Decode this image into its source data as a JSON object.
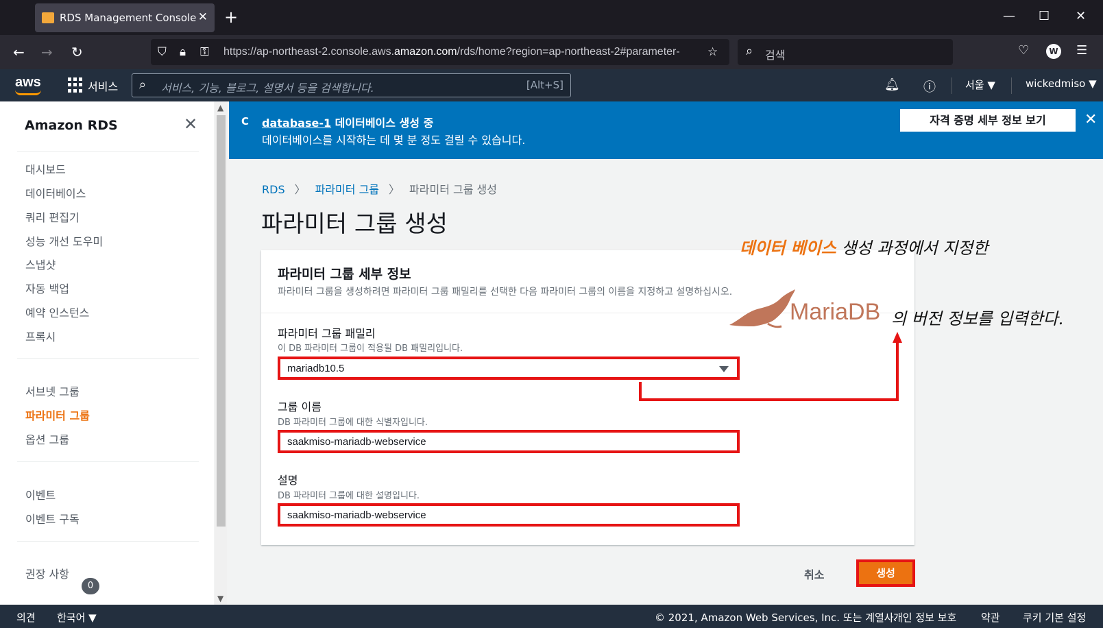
{
  "browser": {
    "tab_title": "RDS Management Console",
    "url_prefix": "https://ap-northeast-2.console.aws.",
    "url_domain": "amazon.com",
    "url_suffix": "/rds/home?region=ap-northeast-2#parameter-",
    "search_placeholder": "검색"
  },
  "aws_header": {
    "logo": "aws",
    "services_label": "서비스",
    "search_placeholder": "서비스, 기능, 블로그, 설명서 등을 검색합니다.",
    "search_shortcut": "[Alt+S]",
    "region": "서울 ▼",
    "account": "wickedmiso ▼"
  },
  "sidebar": {
    "title": "Amazon RDS",
    "items": [
      "대시보드",
      "데이터베이스",
      "쿼리 편집기",
      "성능 개선 도우미",
      "스냅샷",
      "자동 백업",
      "예약 인스턴스",
      "프록시"
    ],
    "items2": [
      "서브넷 그룹",
      "파라미터 그룹",
      "옵션 그룹"
    ],
    "items3": [
      "이벤트",
      "이벤트 구독"
    ],
    "recommendations": "권장 사항",
    "recommendations_count": "0"
  },
  "flash": {
    "db_link": "database-1",
    "title_rest": " 데이터베이스 생성 중",
    "subtitle": "데이터베이스를 시작하는 데 몇 분 정도 걸릴 수 있습니다.",
    "button": "자격 증명 세부 정보 보기"
  },
  "breadcrumb": [
    "RDS",
    "파라미터 그룹",
    "파라미터 그룹 생성"
  ],
  "page_title": "파라미터 그룹 생성",
  "panel": {
    "title": "파라미터 그룹 세부 정보",
    "description": "파라미터 그룹을 생성하려면 파라미터 그룹 패밀리를 선택한 다음 파라미터 그룹의 이름을 지정하고 설명하십시오.",
    "family_label": "파라미터 그룹 패밀리",
    "family_desc": "이 DB 파라미터 그룹이 적용될 DB 패밀리입니다.",
    "family_value": "mariadb10.5",
    "name_label": "그룹 이름",
    "name_desc": "DB 파라미터 그룹에 대한 식별자입니다.",
    "name_value": "saakmiso-mariadb-webservice",
    "desc_label": "설명",
    "desc_desc": "DB 파라미터 그룹에 대한 설명입니다.",
    "desc_value": "saakmiso-mariadb-webservice"
  },
  "actions": {
    "cancel": "취소",
    "create": "생성"
  },
  "annotation": {
    "highlight": "데이터 베이스",
    "line1_rest": " 생성 과정에서 지정한",
    "logo_text": "MariaDB",
    "line2": "의 버전 정보를 입력한다."
  },
  "footer": {
    "feedback": "의견",
    "language": "한국어 ▼",
    "copyright": "© 2021, Amazon Web Services, Inc. 또는 계열사.",
    "privacy": "개인 정보 보호",
    "terms": "약관",
    "cookies": "쿠키 기본 설정"
  },
  "colors": {
    "accent": "#ec7211",
    "flash": "#0073bb",
    "highlight_box": "#e61414",
    "header": "#232f3e"
  }
}
